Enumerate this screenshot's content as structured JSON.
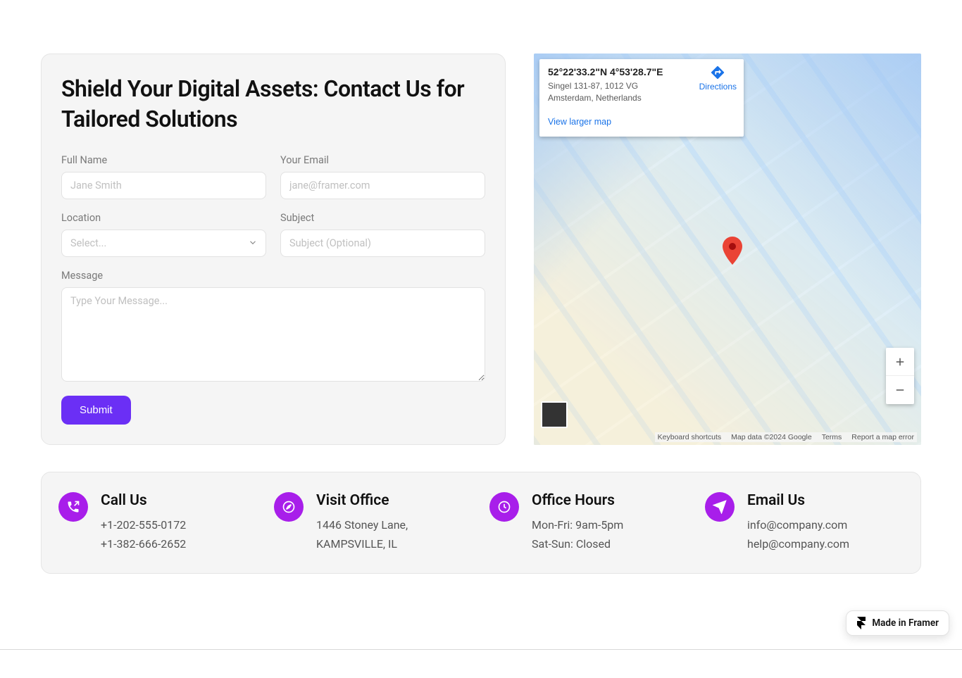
{
  "form": {
    "title": "Shield Your Digital Assets: Contact Us for Tailored Solutions",
    "fullname_label": "Full Name",
    "fullname_placeholder": "Jane Smith",
    "email_label": "Your Email",
    "email_placeholder": "jane@framer.com",
    "location_label": "Location",
    "location_placeholder": "Select...",
    "subject_label": "Subject",
    "subject_placeholder": "Subject (Optional)",
    "message_label": "Message",
    "message_placeholder": "Type Your Message...",
    "submit_label": "Submit"
  },
  "map": {
    "coord": "52°22'33.2\"N 4°53'28.7\"E",
    "address": "Singel 131-87, 1012 VG Amsterdam, Netherlands",
    "directions_label": "Directions",
    "view_larger_label": "View larger map",
    "footer_shortcuts": "Keyboard shortcuts",
    "footer_data": "Map data ©2024 Google",
    "footer_terms": "Terms",
    "footer_report": "Report a map error"
  },
  "contacts": {
    "call": {
      "heading": "Call Us",
      "line1": "+1-202-555-0172",
      "line2": "+1-382-666-2652"
    },
    "visit": {
      "heading": "Visit Office",
      "line1": "1446 Stoney Lane,",
      "line2": "KAMPSVILLE, IL"
    },
    "hours": {
      "heading": "Office Hours",
      "line1": "Mon-Fri: 9am-5pm",
      "line2": "Sat-Sun: Closed"
    },
    "email": {
      "heading": "Email Us",
      "line1": "info@company.com",
      "line2": "help@company.com"
    }
  },
  "framer": {
    "label": "Made in Framer"
  }
}
